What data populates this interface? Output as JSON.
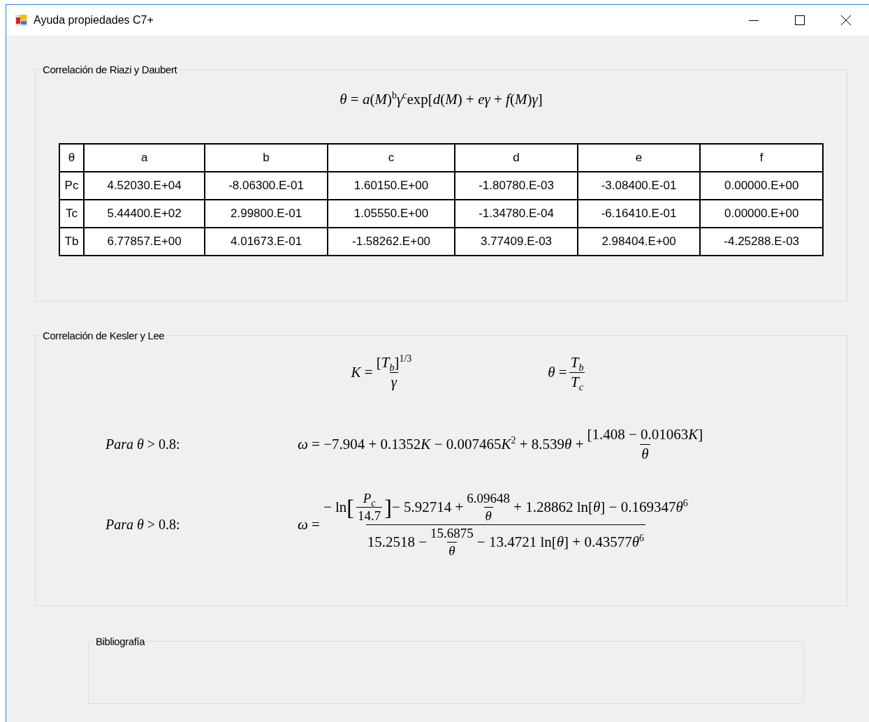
{
  "window": {
    "title": "Ayuda propiedades C7+"
  },
  "groups": [
    {
      "title": "Correlación de Riazi y Daubert",
      "kind": "riazi",
      "formula": [
        {
          "kind": "text",
          "text": "*θ* = *a*(*M*)$^{b}$*γ*$^{c}$exp[*d*(*M*) + *eγ* + *f*(*M*)*γ*]"
        }
      ],
      "table": {
        "columns": [
          "θ",
          "a",
          "b",
          "c",
          "d",
          "e",
          "f"
        ],
        "rows": [
          [
            "Pc",
            "4.52030.E+04",
            "-8.06300.E-01",
            "1.60150.E+00",
            "-1.80780.E-03",
            "-3.08400.E-01",
            "0.00000.E+00"
          ],
          [
            "Tc",
            "5.44400.E+02",
            "2.99800.E-01",
            "1.05550.E+00",
            "-1.34780.E-04",
            "-6.16410.E-01",
            "0.00000.E+00"
          ],
          [
            "Tb",
            "6.77857.E+00",
            "4.01673.E-01",
            "-1.58262.E+00",
            "3.77409.E-03",
            "2.98404.E+00",
            "-4.25288.E-03"
          ]
        ]
      }
    },
    {
      "title": "Correlación de Kesler y Lee",
      "kind": "kesler",
      "definitions": [
        [
          {
            "kind": "text",
            "text": "*K* = "
          },
          {
            "kind": "frac",
            "num": [
              {
                "kind": "text",
                "text": "[*T*$_{b}$]$^{1/3}$"
              }
            ],
            "den": [
              {
                "kind": "text",
                "text": "*γ*"
              }
            ]
          }
        ],
        [
          {
            "kind": "text",
            "text": "*θ* = "
          },
          {
            "kind": "frac",
            "num": [
              {
                "kind": "text",
                "text": "*T*$_{b}$"
              }
            ],
            "den": [
              {
                "kind": "text",
                "text": "*T*$_{c}$"
              }
            ]
          }
        ]
      ],
      "cases": [
        {
          "label": "*Para θ* > 0.8:",
          "formula": [
            {
              "kind": "text",
              "text": "*ω* = −7.904 + 0.1352"
            },
            {
              "kind": "text",
              "text": "*K* − 0.007465"
            },
            {
              "kind": "text",
              "text": "*K*$^{2}$ + 8.539"
            },
            {
              "kind": "text",
              "text": "*θ* + "
            },
            {
              "kind": "frac",
              "num": [
                {
                  "kind": "text",
                  "text": "[1.408 − 0.01063"
                },
                {
                  "kind": "text",
                  "text": "*K*]"
                }
              ],
              "den": [
                {
                  "kind": "text",
                  "text": "*θ*"
                }
              ]
            }
          ]
        },
        {
          "label": "*Para θ* > 0.8:",
          "formula": [
            {
              "kind": "text",
              "text": "*ω* = "
            },
            {
              "kind": "frac",
              "num": [
                {
                  "kind": "text",
                  "text": "− ln"
                },
                {
                  "kind": "big",
                  "text": "["
                },
                {
                  "kind": "frac",
                  "num": [
                    {
                      "kind": "text",
                      "text": "*P*$_{c}$"
                    }
                  ],
                  "den": [
                    {
                      "kind": "text",
                      "text": "14.7"
                    }
                  ]
                },
                {
                  "kind": "big",
                  "text": "]"
                },
                {
                  "kind": "text",
                  "text": " − 5.92714 + "
                },
                {
                  "kind": "frac",
                  "num": [
                    {
                      "kind": "text",
                      "text": "6.09648"
                    }
                  ],
                  "den": [
                    {
                      "kind": "text",
                      "text": "*θ*"
                    }
                  ]
                },
                {
                  "kind": "text",
                  "text": " + 1.28862 ln[*θ*] − 0.169347"
                },
                {
                  "kind": "text",
                  "text": "*θ*$^{6}$"
                }
              ],
              "den": [
                {
                  "kind": "text",
                  "text": "15.2518 − "
                },
                {
                  "kind": "frac",
                  "num": [
                    {
                      "kind": "text",
                      "text": "15.6875"
                    }
                  ],
                  "den": [
                    {
                      "kind": "text",
                      "text": "*θ*"
                    }
                  ]
                },
                {
                  "kind": "text",
                  "text": " − 13.4721 ln[*θ*] + 0.43577"
                },
                {
                  "kind": "text",
                  "text": "*θ*$^{6}$"
                }
              ]
            }
          ]
        }
      ]
    },
    {
      "title": "Bibliografía",
      "kind": "empty"
    }
  ]
}
